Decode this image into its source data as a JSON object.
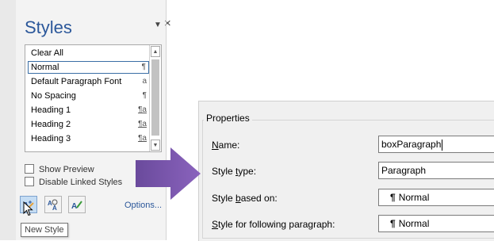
{
  "styles_pane": {
    "title": "Styles",
    "items": [
      {
        "label": "Clear All",
        "mark": "",
        "underline": false
      },
      {
        "label": "Normal",
        "mark": "¶",
        "underline": false,
        "selected": true
      },
      {
        "label": "Default Paragraph Font",
        "mark": "a",
        "underline": false
      },
      {
        "label": "No Spacing",
        "mark": "¶",
        "underline": false
      },
      {
        "label": "Heading 1",
        "mark": "¶a",
        "underline": true
      },
      {
        "label": "Heading 2",
        "mark": "¶a",
        "underline": true
      },
      {
        "label": "Heading 3",
        "mark": "¶a",
        "underline": true
      }
    ],
    "show_preview_label": "Show Preview",
    "disable_linked_label": "Disable Linked Styles",
    "options_label": "Options...",
    "tooltip": "New Style"
  },
  "properties": {
    "title": "Properties",
    "rows": [
      {
        "label_key": "N",
        "label_rest": "ame:",
        "value": "boxParagraph"
      },
      {
        "label_pre": "Style ",
        "label_key": "t",
        "label_rest": "ype:",
        "value": "Paragraph"
      },
      {
        "label_pre": "Style ",
        "label_key": "b",
        "label_rest": "ased on:",
        "value": "Normal"
      },
      {
        "label_key": "S",
        "label_rest": "tyle for following paragraph:",
        "value": "Normal"
      }
    ]
  },
  "colors": {
    "accent": "#2b579a",
    "arrow": "#7b52a8"
  }
}
